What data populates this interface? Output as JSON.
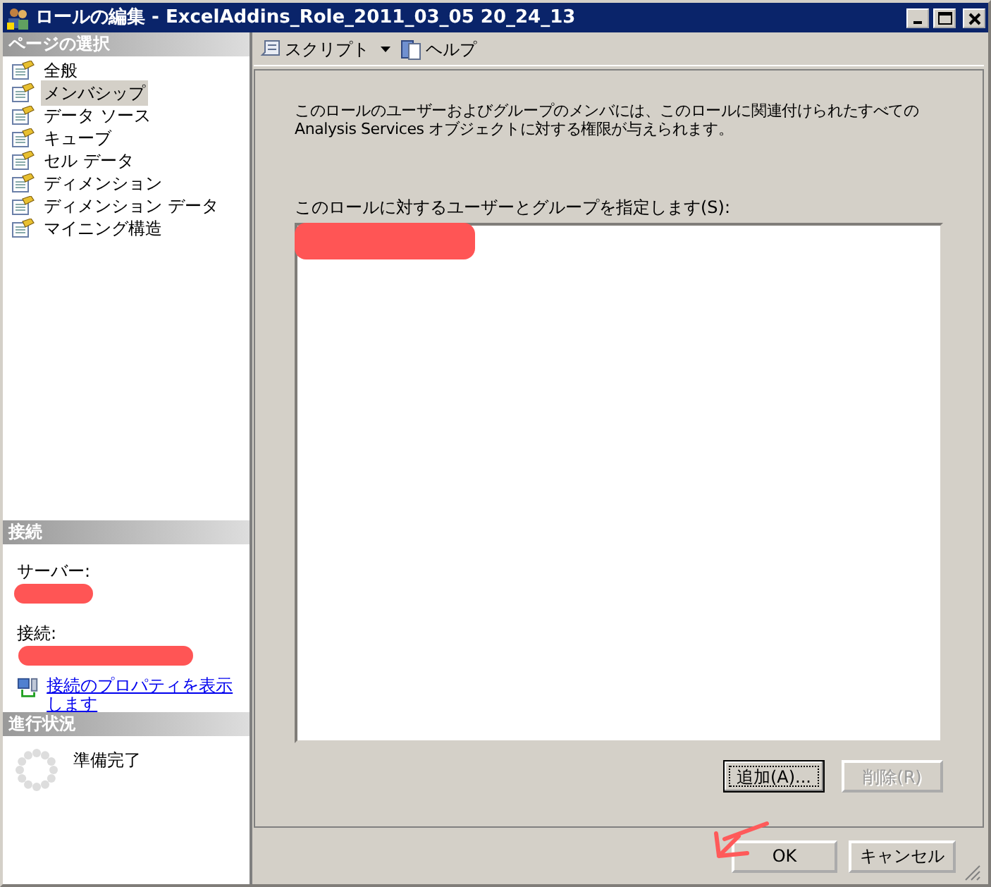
{
  "window": {
    "title": "ロールの編集 - ExcelAddins_Role_2011_03_05 20_24_13"
  },
  "sidebar": {
    "title": "ページの選択",
    "items": [
      {
        "label": "全般",
        "selected": false
      },
      {
        "label": "メンバシップ",
        "selected": true
      },
      {
        "label": "データ ソース",
        "selected": false
      },
      {
        "label": "キューブ",
        "selected": false
      },
      {
        "label": "セル データ",
        "selected": false
      },
      {
        "label": "ディメンション",
        "selected": false
      },
      {
        "label": "ディメンション データ",
        "selected": false
      },
      {
        "label": "マイニング構造",
        "selected": false
      }
    ]
  },
  "connection": {
    "title": "接続",
    "server_label": "サーバー:",
    "connection_label": "接続:",
    "link": "接続のプロパティを表示します"
  },
  "progress": {
    "title": "進行状況",
    "status": "準備完了"
  },
  "toolbar": {
    "items": [
      {
        "label": "スクリプト",
        "kind": "dropdown"
      },
      {
        "label": "ヘルプ",
        "kind": "button"
      }
    ]
  },
  "description": "このロールのユーザーおよびグループのメンバには、このロールに関連付けられたすべての Analysis Services オブジェクトに対する権限が与えられます。",
  "list_label": "このロールに対するユーザーとグループを指定します(S):",
  "list_buttons": [
    {
      "label": "追加(A)...",
      "disabled": false,
      "focused": true
    },
    {
      "label": "削除(R)",
      "disabled": true,
      "focused": false
    }
  ],
  "dialog_buttons": [
    {
      "label": "OK"
    },
    {
      "label": "キャンセル"
    }
  ]
}
